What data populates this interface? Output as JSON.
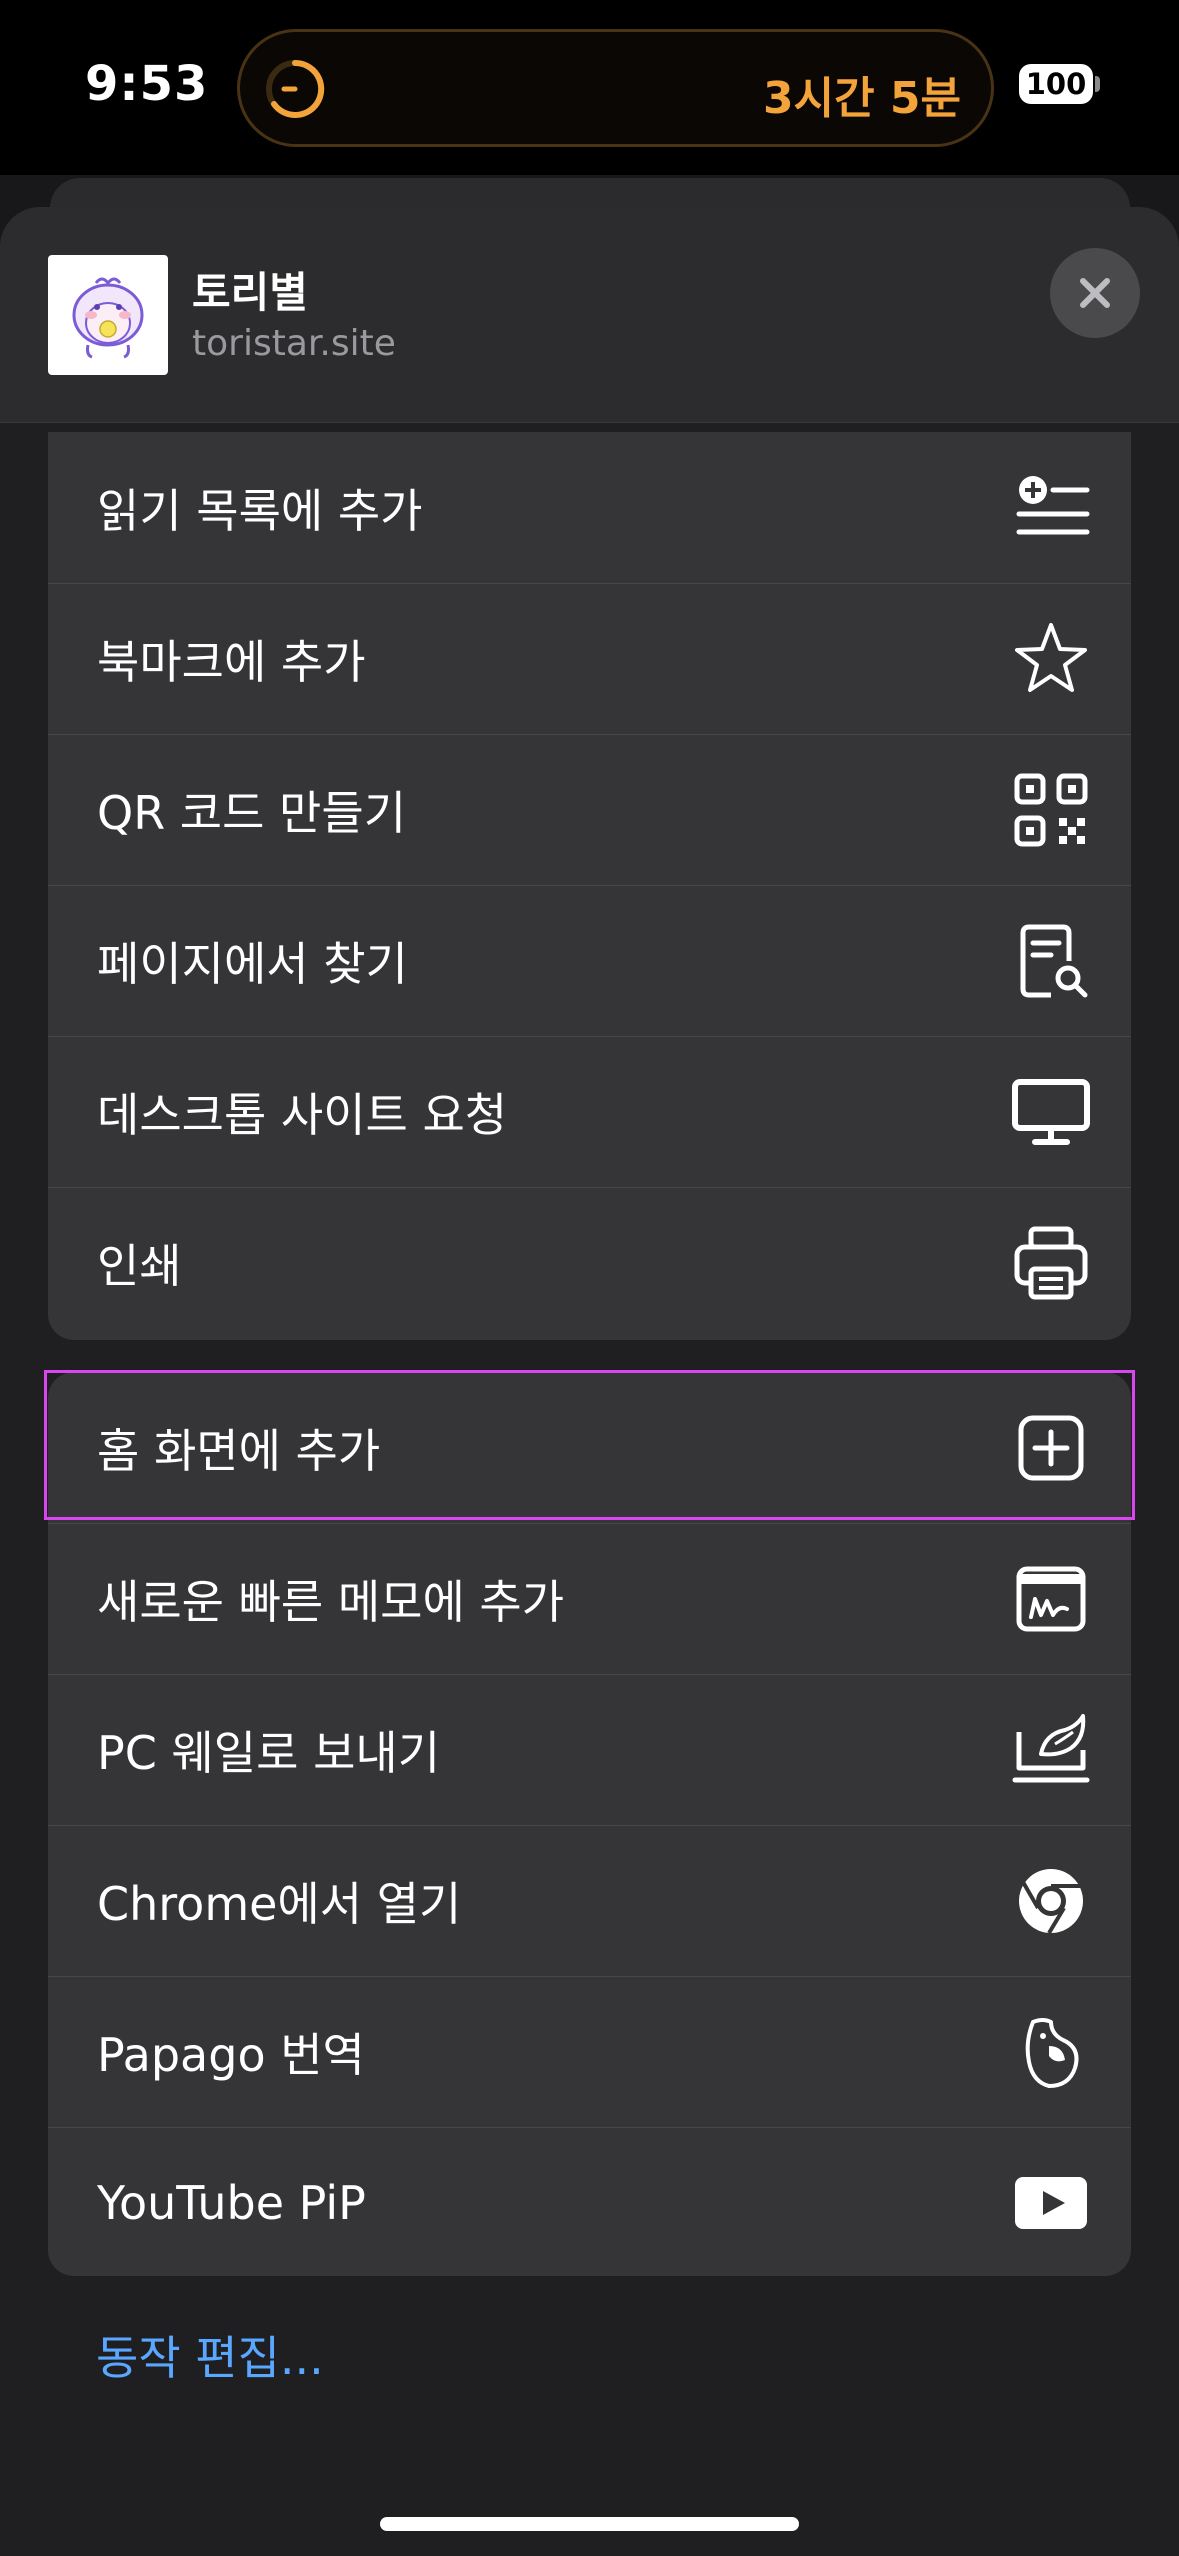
{
  "status_bar": {
    "time": "9:53",
    "timer_text": "3시간 5분",
    "battery": "100",
    "accent_color": "#f2a33a"
  },
  "header": {
    "site_name": "토리별",
    "site_url": "toristar.site",
    "icon": "app-logo-icon",
    "close_icon": "close-icon"
  },
  "actions_group1": [
    {
      "label": "읽기 목록에 추가",
      "icon": "reading-list-icon"
    },
    {
      "label": "북마크에 추가",
      "icon": "star-icon"
    },
    {
      "label": "QR 코드 만들기",
      "icon": "qr-code-icon"
    },
    {
      "label": "페이지에서 찾기",
      "icon": "find-in-page-icon"
    },
    {
      "label": "데스크톱 사이트 요청",
      "icon": "desktop-icon"
    },
    {
      "label": "인쇄",
      "icon": "printer-icon"
    }
  ],
  "actions_group2": [
    {
      "label": "홈 화면에 추가",
      "icon": "add-square-icon"
    },
    {
      "label": "새로운 빠른 메모에 추가",
      "icon": "quick-note-icon"
    },
    {
      "label": "PC 웨일로 보내기",
      "icon": "whale-icon"
    },
    {
      "label": "Chrome에서 열기",
      "icon": "chrome-icon"
    },
    {
      "label": "Papago 번역",
      "icon": "papago-icon"
    },
    {
      "label": "YouTube PiP",
      "icon": "youtube-icon"
    }
  ],
  "footer": {
    "edit_actions": "동작 편집...",
    "link_color": "#5aa7ff"
  }
}
